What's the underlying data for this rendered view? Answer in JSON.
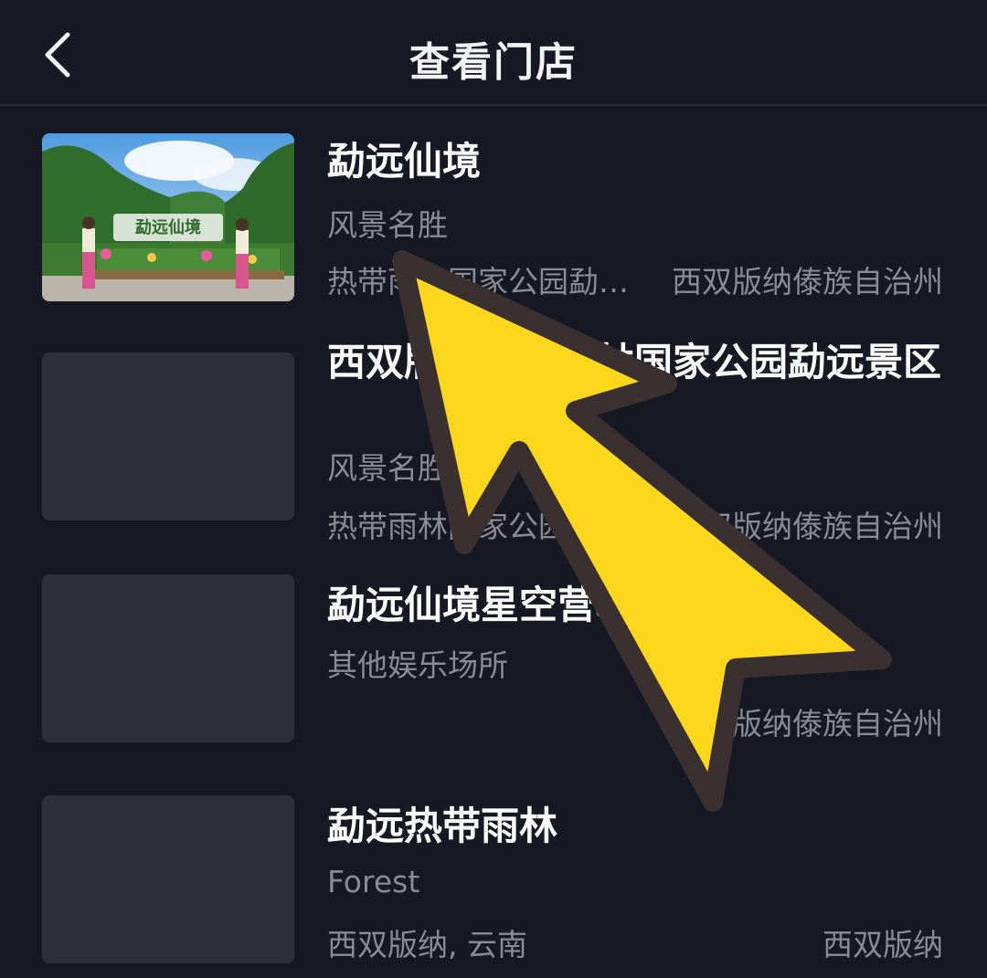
{
  "header": {
    "title": "查看门店"
  },
  "stores": [
    {
      "name": "勐远仙境",
      "category": "风景名胜",
      "address": "热带雨林国家公园勐远仙境",
      "region": "西双版纳傣族自治州",
      "has_photo": true,
      "photo_sign": "勐远仙境"
    },
    {
      "name": "西双版纳热带雨林国家公园勐远景区",
      "category": "风景名胜",
      "address": "热带雨林国家公园勐远景区",
      "region": "西双版纳傣族自治州",
      "has_photo": false
    },
    {
      "name": "勐远仙境星空营地",
      "category": "其他娱乐场所",
      "address": "",
      "region": "西双版纳傣族自治州",
      "has_photo": false
    },
    {
      "name": "勐远热带雨林",
      "category": "Forest",
      "address": "西双版纳, 云南",
      "region": "西双版纳",
      "has_photo": false
    }
  ],
  "colors": {
    "background": "#161823",
    "placeholder": "#2d2f3a",
    "arrow_fill": "#fdd71c",
    "arrow_outline": "#3a3030",
    "secondary_text": "#8a8b93"
  }
}
